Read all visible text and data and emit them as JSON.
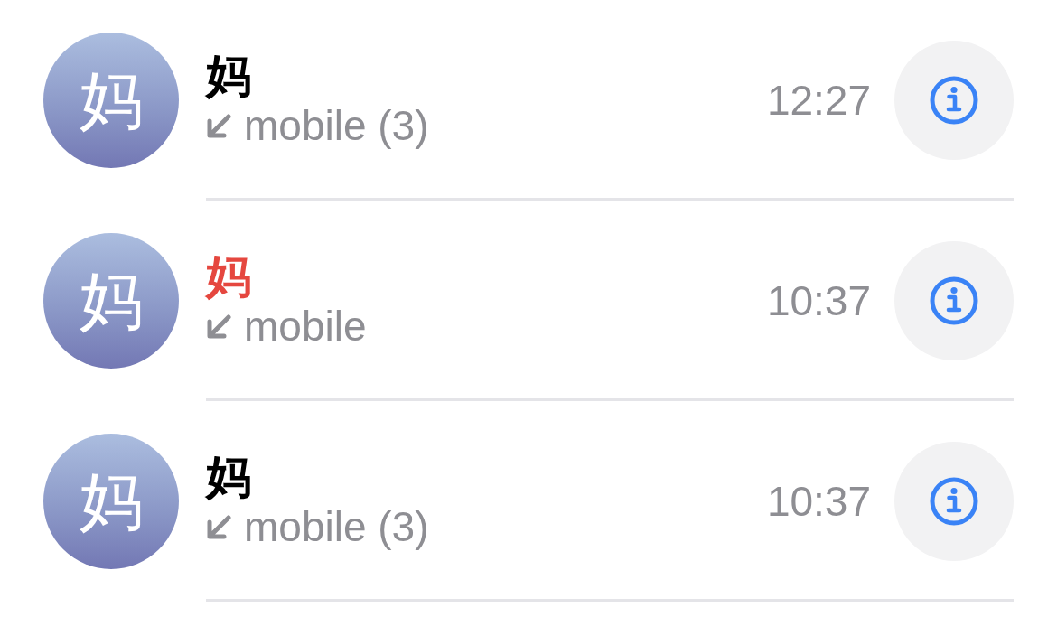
{
  "calls": [
    {
      "avatar": "妈",
      "name": "妈",
      "missed": false,
      "detail": "mobile (3)",
      "time": "12:27"
    },
    {
      "avatar": "妈",
      "name": "妈",
      "missed": true,
      "detail": "mobile",
      "time": "10:37"
    },
    {
      "avatar": "妈",
      "name": "妈",
      "missed": false,
      "detail": "mobile (3)",
      "time": "10:37"
    }
  ]
}
